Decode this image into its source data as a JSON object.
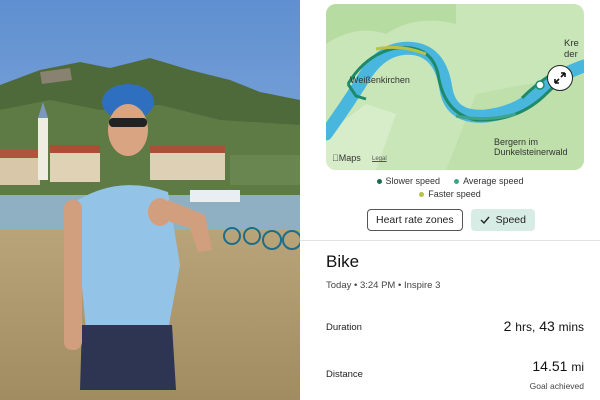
{
  "map": {
    "town_1": "Weißenkirchen",
    "town_2": "Bergern im Dunkelsteinerwald",
    "town_3": "Krems an der",
    "town_3_visible": "Kre\nder",
    "attribution": "Maps",
    "legal": "Legal",
    "expand_icon": "expand-arrows-icon",
    "colors": {
      "land": "#c9e6b8",
      "river": "#49b6dd",
      "route": "#1e8a6a"
    }
  },
  "legend": {
    "slower": {
      "label": "Slower speed",
      "color": "#1d6b52"
    },
    "average": {
      "label": "Average speed",
      "color": "#3fa38a"
    },
    "faster": {
      "label": "Faster speed",
      "color": "#b8c24a"
    }
  },
  "toggles": {
    "heart_rate": "Heart rate zones",
    "speed": "Speed",
    "selected": "speed"
  },
  "activity": {
    "title": "Bike",
    "meta": "Today • 3:24 PM • Inspire 3"
  },
  "stats": {
    "duration_label": "Duration",
    "duration_hours": "2",
    "duration_hours_unit": "hrs,",
    "duration_mins": "43",
    "duration_mins_unit": "mins",
    "distance_label": "Distance",
    "distance_value": "14.51",
    "distance_unit": "mi",
    "goal": "Goal achieved"
  }
}
